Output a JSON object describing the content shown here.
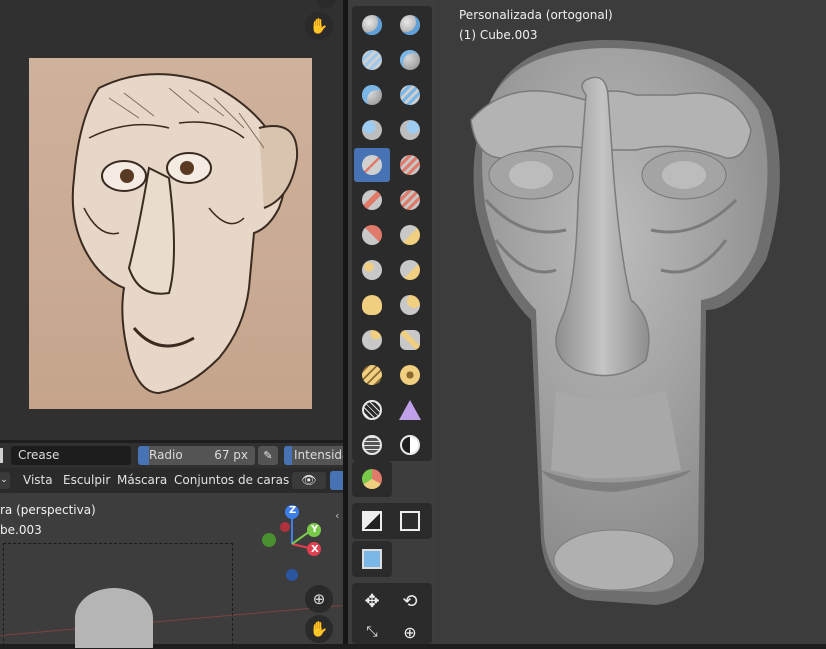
{
  "image_editor": {
    "nav_icons": [
      "hand-icon"
    ]
  },
  "brush_header": {
    "brush_name": "Crease",
    "radius_label": "Radio",
    "radius_value": "67 px",
    "strength_label": "Intensidad"
  },
  "sculpt_menu": {
    "items": [
      "Vista",
      "Esculpir",
      "Máscara",
      "Conjuntos de caras"
    ]
  },
  "small_viewport": {
    "view_label": "ra (perspectiva)",
    "object_label": "be.003",
    "gizmo": {
      "z": "Z",
      "y": "Y",
      "x": "X"
    }
  },
  "main_viewport": {
    "view_label": "Personalizada (ortogonal)",
    "object_label": "(1) Cube.003"
  },
  "colors": {
    "active_tool": "#4772b3",
    "axis_x": "#e0404f",
    "axis_y": "#7ac84a",
    "axis_z": "#3d7ee8"
  }
}
